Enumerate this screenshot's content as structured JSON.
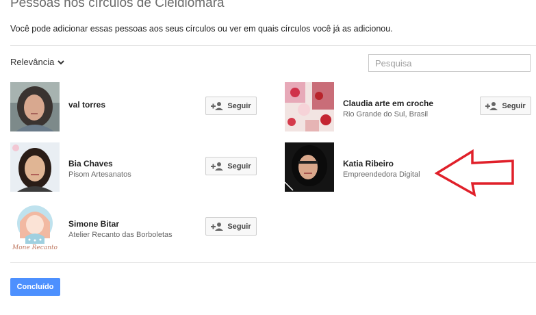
{
  "dialog": {
    "title": "Pessoas nos círculos de Cleidiomara",
    "subtitle": "Você pode adicionar essas pessoas aos seus círculos ou ver em quais círculos você já as adicionou."
  },
  "toolbar": {
    "sort_label": "Relevância",
    "search_placeholder": "Pesquisa"
  },
  "people": [
    {
      "name": "val torres",
      "description": "",
      "button_label": "Seguir"
    },
    {
      "name": "Claudia arte em croche",
      "description": "Rio Grande do Sul, Brasil",
      "button_label": "Seguir"
    },
    {
      "name": "Bia Chaves",
      "description": "Pisom Artesanatos",
      "button_label": "Seguir"
    },
    {
      "name": "Katia Ribeiro",
      "description": "Empreendedora Digital"
    },
    {
      "name": "Simone Bitar",
      "description": "Atelier Recanto das Borboletas",
      "button_label": "Seguir"
    }
  ],
  "avatar_texts": {
    "simone": "Mone Recanto"
  },
  "footer": {
    "done_label": "Concluído"
  },
  "colors": {
    "primary": "#4d90fe",
    "annotation_arrow": "#e0202a"
  },
  "icons": {
    "follow": "add-person-icon",
    "sort": "chevron-down-icon"
  }
}
